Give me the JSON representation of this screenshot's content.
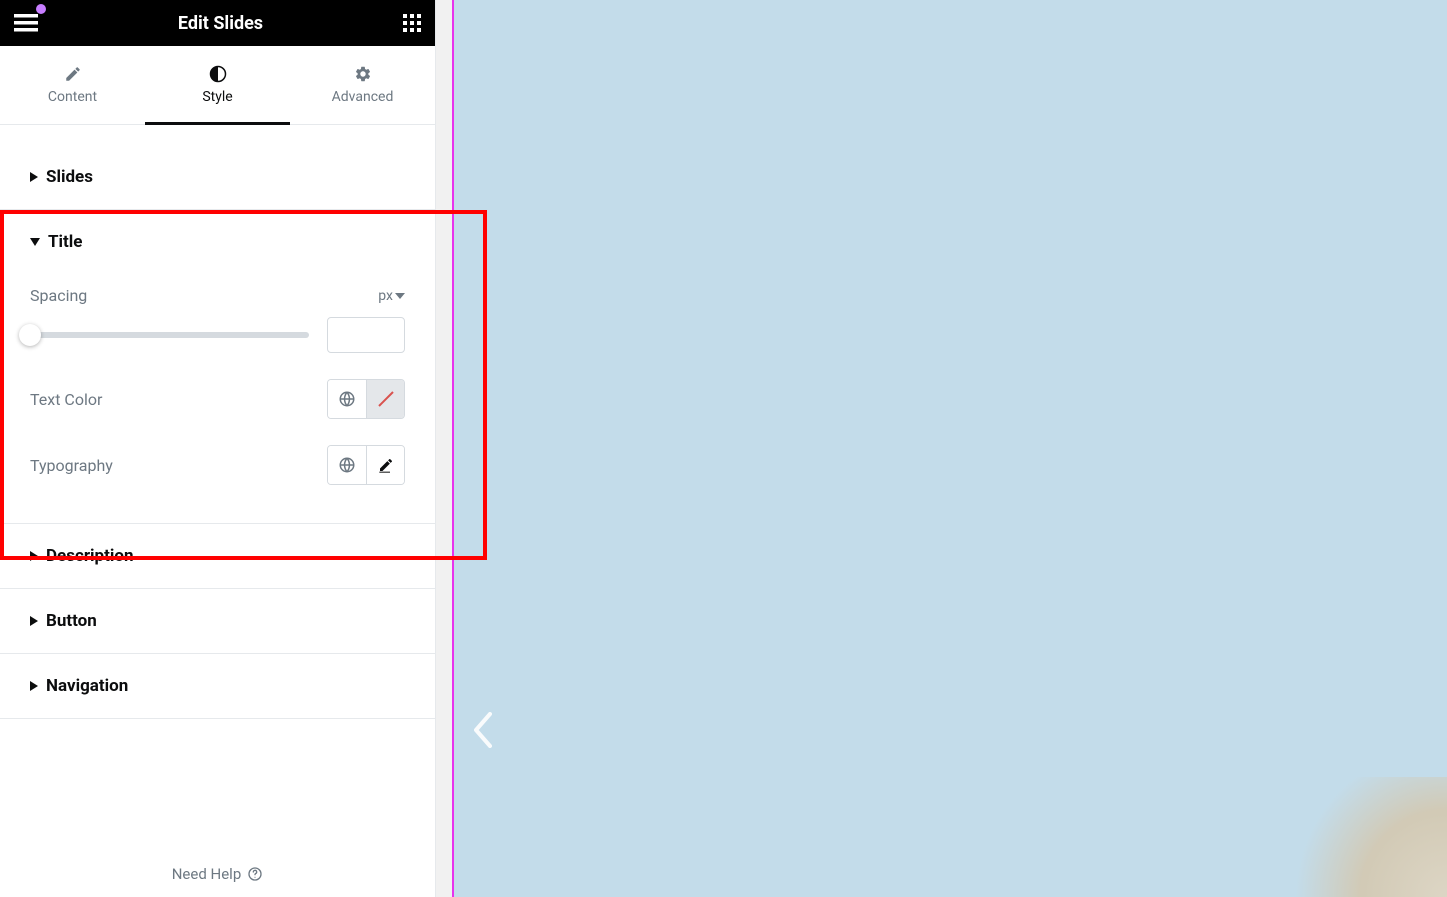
{
  "header": {
    "title": "Edit Slides"
  },
  "tabs": {
    "content": "Content",
    "style": "Style",
    "advanced": "Advanced"
  },
  "sections": {
    "slides": "Slides",
    "title": "Title",
    "description": "Description",
    "button": "Button",
    "navigation": "Navigation"
  },
  "title_panel": {
    "spacing_label": "Spacing",
    "spacing_unit": "px",
    "spacing_value": "",
    "text_color_label": "Text Color",
    "typography_label": "Typography"
  },
  "footer": {
    "need_help": "Need Help"
  }
}
